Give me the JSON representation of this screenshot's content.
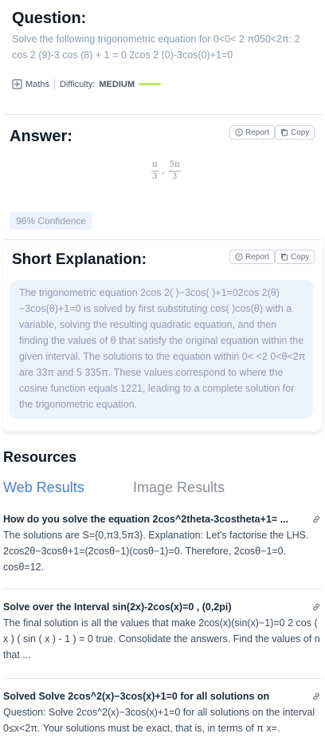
{
  "question": {
    "heading": "Question:",
    "text": "Solve the following trigonometric equation for 0<0< 2 π050<2π: 2 cos 2 (9)-3 cos (8) + 1 = 0 2cos 2 (0)-3cos(0)+1=0",
    "subject": "Maths",
    "difficulty_label": "Difficulty:",
    "difficulty_value": "MEDIUM"
  },
  "answer": {
    "heading": "Answer:",
    "report_label": "Report",
    "copy_label": "Copy",
    "fractions": [
      {
        "num": "π",
        "den": "3"
      },
      {
        "num": "5π",
        "den": "3"
      }
    ],
    "separator": ",",
    "confidence": "96% Confidence"
  },
  "explanation": {
    "heading": "Short Explanation:",
    "report_label": "Report",
    "copy_label": "Copy",
    "text": "The trigonometric equation 2cos 2(   )−3cos(   )+1=02cos 2(θ)−3cos(θ)+1=0 is solved by first substituting cos(   )cos(θ) with a variable, solving the resulting quadratic equation, and then finding the values of θ that satisfy the original equation within the given interval.  The solutions to the equation within 0<   <2   0<θ<2π are   33π and 5   335π. These values correspond to where the cosine function equals 1221, leading to a complete solution for the trigonometric equation."
  },
  "resources": {
    "heading": "Resources",
    "tabs": {
      "web": "Web Results",
      "image": "Image Results"
    },
    "results": [
      {
        "title": "How do you solve the equation 2cos^2theta-3costheta+1= ...",
        "snippet": "The solutions are S={0,π3,5π3}. Explanation: Let's factorise the LHS. 2cos2θ−3cosθ+1=(2cosθ−1)(cosθ−1)=0. Therefore, 2cosθ−1=0. cosθ=12."
      },
      {
        "title": "Solve over the Interval sin(2x)-2cos(x)=0 , (0,2pi)",
        "snippet": "The final solution is all the values that make 2cos(x)(sin(x)−1)=0 2 cos ( x ) ( sin ( x ) - 1 ) = 0 true. Consolidate the answers. Find the values of n that ..."
      },
      {
        "title": "Solved Solve 2cos^2(x)−3cos(x)+1=0 for all solutions on",
        "snippet": "Question: Solve 2cos^2(x)−3cos(x)+1=0 for all solutions on the interval 0≤x<2π. Your solutions must be exact, that is, in terms of π x=."
      }
    ]
  },
  "colors": {
    "accent": "#4a7ed8",
    "difficulty_bar": "#c9e46a",
    "explanation_bg": "#eef2fb"
  }
}
